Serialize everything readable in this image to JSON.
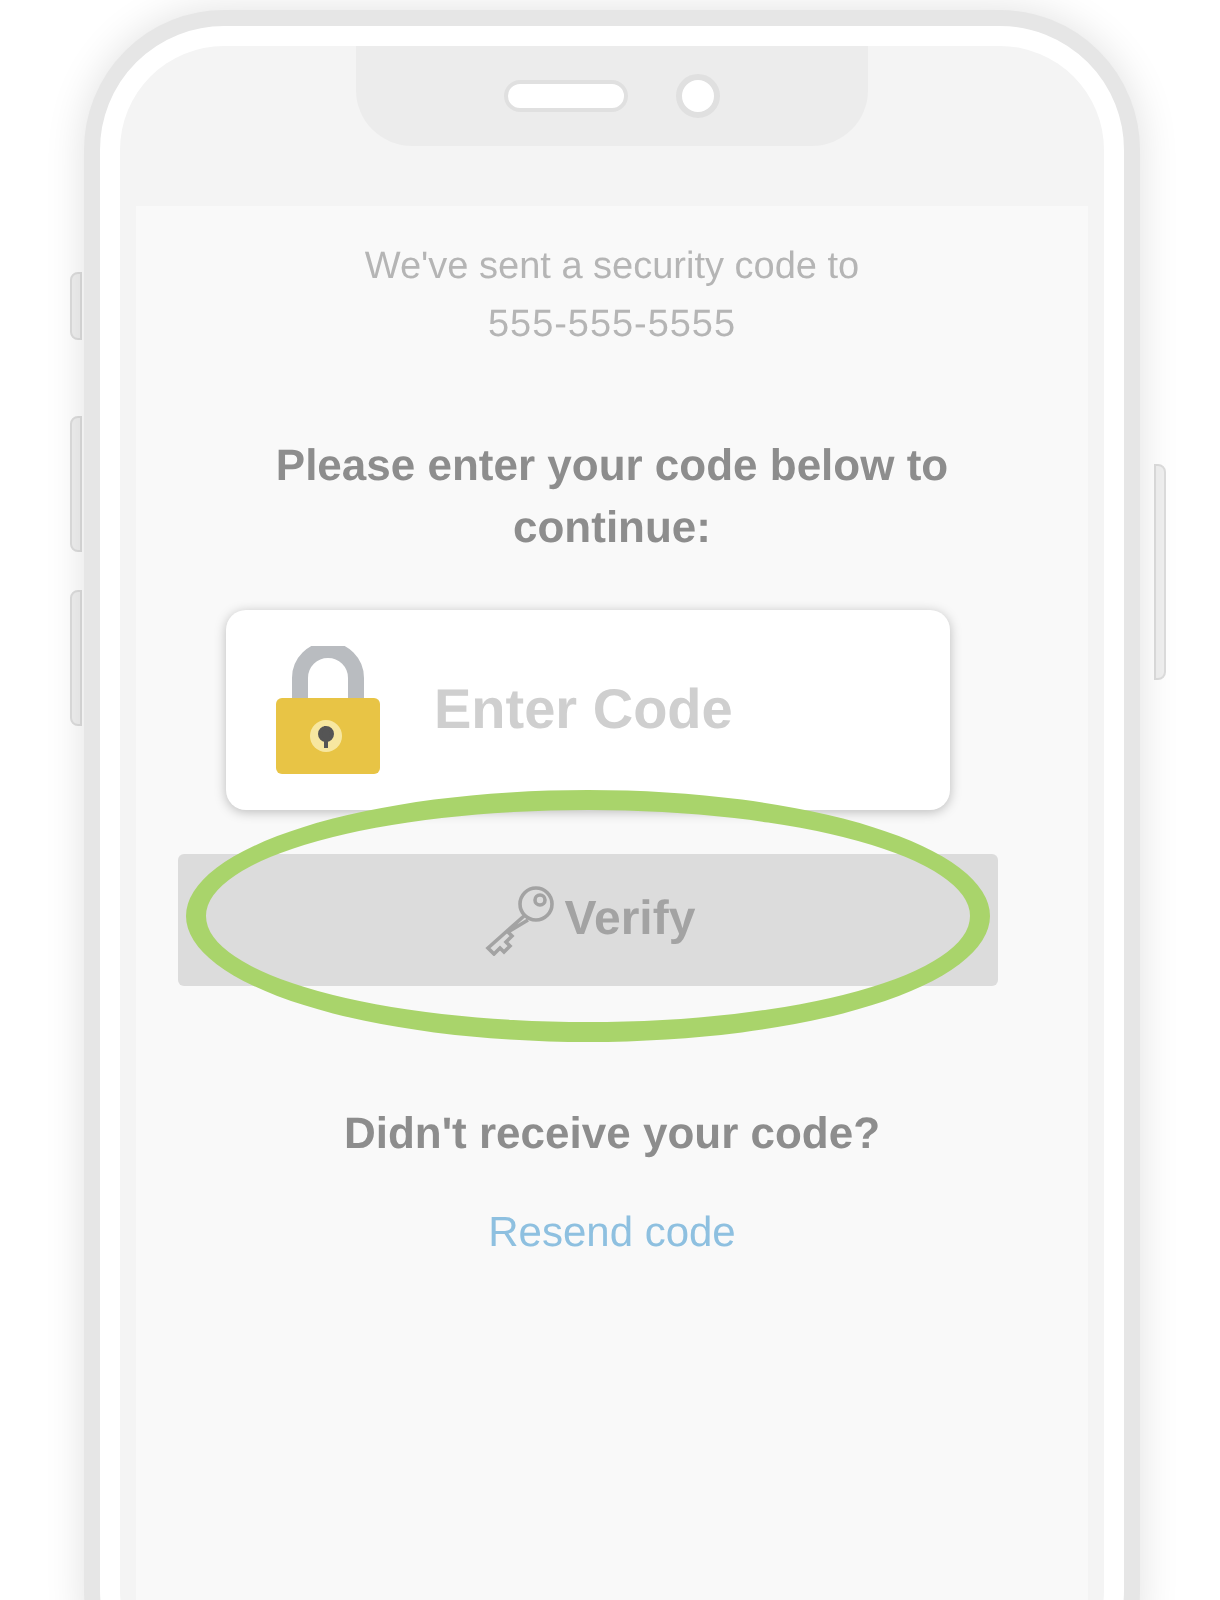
{
  "message": {
    "line_1": "We've sent a security code to",
    "phone_number": "555-555-5555"
  },
  "prompt": "Please enter your code below to continue:",
  "code_field": {
    "placeholder": "Enter Code"
  },
  "verify_button": {
    "label": "Verify",
    "disabled": true,
    "highlighted": true
  },
  "resend": {
    "question": "Didn't receive your code?",
    "link": "Resend code"
  }
}
